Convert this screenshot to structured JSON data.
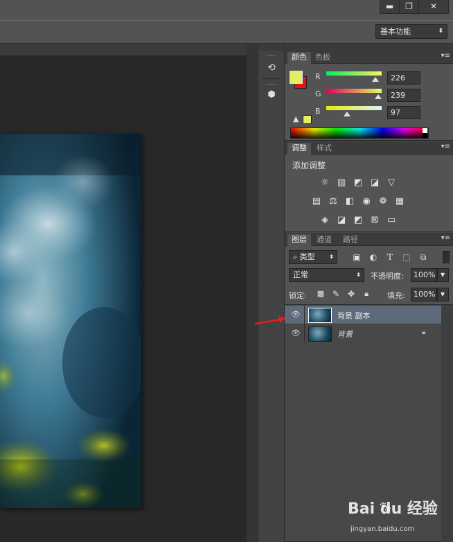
{
  "window": {
    "minimize_glyph": "▬",
    "restore_glyph": "❐",
    "close_glyph": "✕"
  },
  "options_bar": {
    "workspace_label": "基本功能",
    "workspace_arrow": "⬍"
  },
  "color_panel": {
    "tabs": [
      "颜色",
      "色板"
    ],
    "foreground_color": "#e2ef61",
    "background_color": "#e81010",
    "channels": [
      {
        "label": "R",
        "value": "226",
        "fraction": 0.886
      },
      {
        "label": "G",
        "value": "239",
        "fraction": 0.937
      },
      {
        "label": "B",
        "value": "97",
        "fraction": 0.38
      }
    ],
    "warning_glyph": "▲"
  },
  "adjustments_panel": {
    "tabs": [
      "调整",
      "样式"
    ],
    "title": "添加调整",
    "row1": [
      "☼",
      "▥",
      "◩",
      "◪",
      "▽"
    ],
    "row2": [
      "▤",
      "⚖",
      "◧",
      "❁",
      "▦"
    ],
    "row3": [
      "◈",
      "◪",
      "◩",
      "⊠",
      "▭"
    ]
  },
  "layers_panel": {
    "tabs": [
      "图层",
      "通道",
      "路径"
    ],
    "filter_label": "类型",
    "filter_icon": "⌕",
    "blend_mode": "正常",
    "opacity_label": "不透明度:",
    "opacity_value": "100%",
    "lock_label": "锁定:",
    "fill_label": "填充:",
    "fill_value": "100%",
    "layers": [
      {
        "name": "背景 副本",
        "selected": true,
        "locked": false
      },
      {
        "name": "背景",
        "selected": false,
        "locked": true
      }
    ]
  },
  "watermark": {
    "brand": "Bai du 经验",
    "url": "jingyan.baidu.com"
  }
}
